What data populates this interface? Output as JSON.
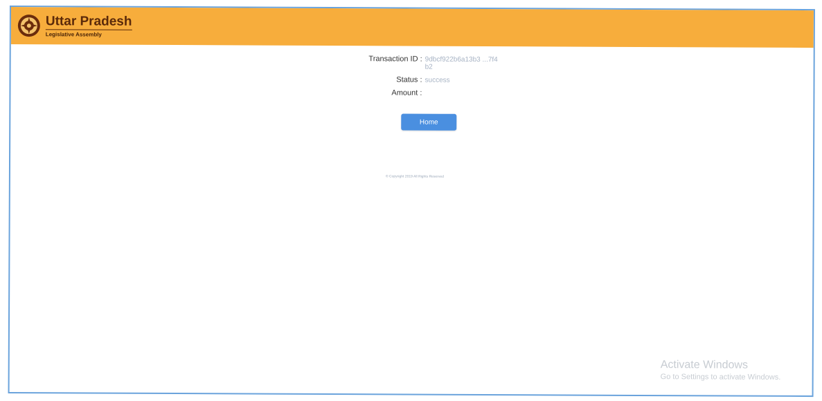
{
  "header": {
    "title": "Uttar Pradesh",
    "subtitle": "Legislative Assembly",
    "emblem_icon": "up-state-emblem-icon",
    "background_color": "#f7ad3c"
  },
  "receipt": {
    "transaction_id_label": "Transaction ID :",
    "transaction_id_value": "9dbcf922b6a13b3 ...7f4b2",
    "status_label": "Status :",
    "status_value": "success",
    "amount_label": "Amount :",
    "amount_value": ""
  },
  "buttons": {
    "home_label": "Home",
    "home_color": "#4a8fe0"
  },
  "footer": {
    "copyright": "© Copyright 2019 All Rights Reserved"
  },
  "watermark": {
    "line1": "Activate Windows",
    "line2": "Go to Settings to activate Windows."
  }
}
